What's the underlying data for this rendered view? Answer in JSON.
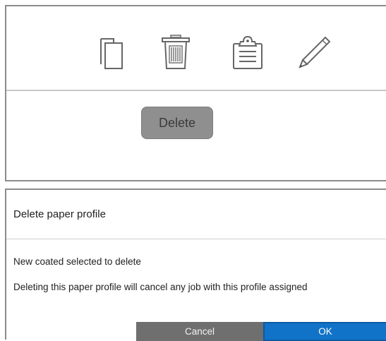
{
  "toolbar": {
    "icons": [
      {
        "name": "copy-icon",
        "label": "Copy"
      },
      {
        "name": "trash-icon",
        "label": "Delete"
      },
      {
        "name": "paste-icon",
        "label": "Paste"
      },
      {
        "name": "pencil-icon",
        "label": "Edit"
      }
    ],
    "tooltip_label": "Delete"
  },
  "dialog": {
    "title": "Delete paper profile",
    "message": "New coated selected to delete",
    "warning": "Deleting this paper profile will cancel any job with this profile assigned",
    "cancel_label": "Cancel",
    "ok_label": "OK"
  },
  "colors": {
    "ok_button": "#1173c7",
    "cancel_button": "#6f6f6f",
    "tooltip_background": "#8f8f8f",
    "icon_stroke": "#555555"
  }
}
